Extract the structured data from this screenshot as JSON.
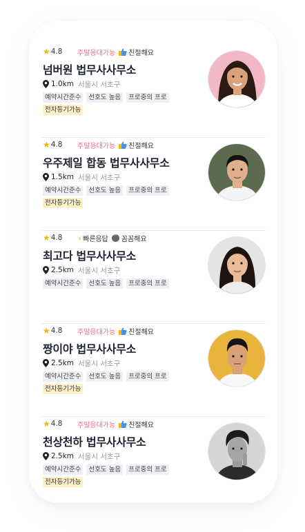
{
  "lawyers": [
    {
      "rating": "4.8",
      "badge1": "주말응대가능",
      "badge1_style": "pink",
      "badge2": "친절해요",
      "badge2_icon": "thumbs-up-icon",
      "name": "넘버원 법무사사무소",
      "distance": "1.0km",
      "region": "서울시 서초구",
      "tags": [
        "예약시간준수",
        "선호도 높음",
        "프로중의 프로"
      ],
      "highlight_tag": "전자등기가능",
      "avatar_bg": "#f2b8c6",
      "avatar_skin": "#d9a27c",
      "avatar_hair": "#2a1a14",
      "avatar_shirt": "#ffffff"
    },
    {
      "rating": "4.8",
      "badge1": "주말응대가능",
      "badge1_style": "pink",
      "badge2": "친절해요",
      "badge2_icon": "thumbs-up-icon",
      "name": "우주제일 합동 법무사사무소",
      "distance": "1.5km",
      "region": "서울시 서초구",
      "tags": [
        "예약시간준수",
        "선호도 높음",
        "프로중의 프로"
      ],
      "highlight_tag": "전자등기가능",
      "avatar_bg": "#5c6b4f",
      "avatar_skin": "#e0b08c",
      "avatar_hair": "#111111",
      "avatar_shirt": "#f4f4f4"
    },
    {
      "rating": "4.8",
      "badge1": "빠른응답",
      "badge1_style": "dark",
      "badge2": "꼼꼼해요",
      "badge2_icon": "chat-bubble-icon",
      "name": "최고다 법무사사무소",
      "distance": "2.5km",
      "region": "서울시 서초구",
      "tags": [
        "예약시간준수",
        "선호도 높음",
        "프로중의 프로"
      ],
      "highlight_tag": "",
      "avatar_bg": "#e4e4e4",
      "avatar_skin": "#e8bc98",
      "avatar_hair": "#1e130e",
      "avatar_shirt": "#ededed"
    },
    {
      "rating": "4.8",
      "badge1": "주말응대가능",
      "badge1_style": "pink",
      "badge2": "친절해요",
      "badge2_icon": "thumbs-up-icon",
      "name": "짱이야 법무사사무소",
      "distance": "2.5km",
      "region": "서울시 서초구",
      "tags": [
        "예약시간준수",
        "선호도 높음",
        "프로중의 프로"
      ],
      "highlight_tag": "전자등기가능",
      "avatar_bg": "#e9b43c",
      "avatar_skin": "#d9a07a",
      "avatar_hair": "#151515",
      "avatar_shirt": "#f7f7f7"
    },
    {
      "rating": "4.8",
      "badge1": "주말응대가능",
      "badge1_style": "pink",
      "badge2": "친절해요",
      "badge2_icon": "thumbs-up-icon",
      "name": "천상천하 법무사사무소",
      "distance": "2.5km",
      "region": "서울시 서초구",
      "tags": [
        "예약시간준수",
        "선호도 높음",
        "프로중의 프로"
      ],
      "highlight_tag": "전자등기가능",
      "avatar_bg": "#d6d6d6",
      "avatar_skin": "#9a9a9a",
      "avatar_hair": "#1c1c1c",
      "avatar_shirt": "#2b2b2b"
    }
  ]
}
